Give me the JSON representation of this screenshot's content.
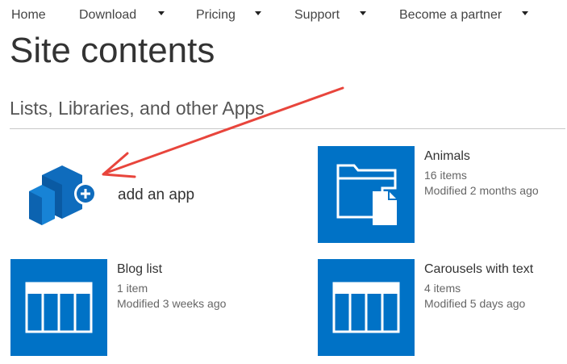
{
  "nav": {
    "items": [
      {
        "label": "Home",
        "has_dropdown": false
      },
      {
        "label": "Download",
        "has_dropdown": true
      },
      {
        "label": "Pricing",
        "has_dropdown": true
      },
      {
        "label": "Support",
        "has_dropdown": true
      },
      {
        "label": "Become a partner",
        "has_dropdown": true
      }
    ]
  },
  "page": {
    "title": "Site contents",
    "section_heading": "Lists, Libraries, and other Apps"
  },
  "add_app": {
    "label": "add an app",
    "icon": "app-cubes-plus-icon"
  },
  "tiles": [
    {
      "name": "Animals",
      "count": "16 items",
      "modified": "Modified 2 months ago",
      "icon": "folder-document-icon"
    },
    {
      "name": "Blog list",
      "count": "1 item",
      "modified": "Modified 3 weeks ago",
      "icon": "list-table-icon"
    },
    {
      "name": "Carousels with text",
      "count": "4 items",
      "modified": "Modified 5 days ago",
      "icon": "list-table-icon"
    }
  ],
  "colors": {
    "tile_background": "#0072c6",
    "annotation_arrow": "#e8453c",
    "text": "#333333"
  }
}
